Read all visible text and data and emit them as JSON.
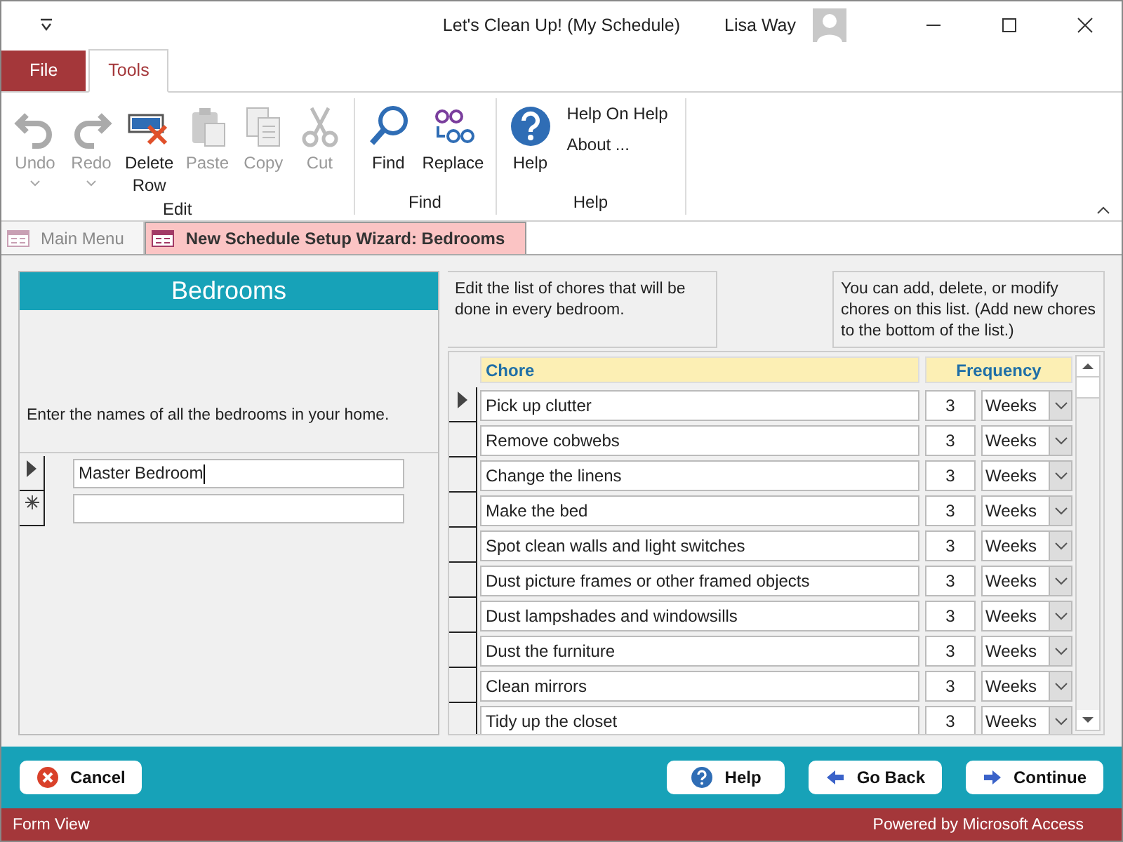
{
  "window": {
    "title": "Let's Clean Up! (My Schedule)",
    "user": "Lisa Way"
  },
  "ribbon_tabs": [
    {
      "label": "File",
      "kind": "file",
      "selected": false
    },
    {
      "label": "Tools",
      "kind": "tab",
      "selected": true
    }
  ],
  "ribbon_groups": [
    {
      "label": "Edit",
      "buttons": [
        {
          "label": "Undo",
          "kind": "large",
          "disabled": true,
          "dropdown": true
        },
        {
          "label": "Redo",
          "kind": "large",
          "disabled": true,
          "dropdown": true
        },
        {
          "label": "Delete Row",
          "kind": "large",
          "disabled": false
        },
        {
          "label": "Paste",
          "kind": "large",
          "disabled": true
        },
        {
          "label": "Copy",
          "kind": "large",
          "disabled": true
        },
        {
          "label": "Cut",
          "kind": "large",
          "disabled": true
        }
      ]
    },
    {
      "label": "Find",
      "buttons": [
        {
          "label": "Find",
          "kind": "large",
          "disabled": false
        },
        {
          "label": "Replace",
          "kind": "large",
          "disabled": false
        }
      ]
    },
    {
      "label": "Help",
      "buttons": [
        {
          "label": "Help",
          "kind": "large",
          "disabled": false
        },
        {
          "label": "Help On Help",
          "kind": "small",
          "disabled": false
        },
        {
          "label": "About ...",
          "kind": "small",
          "disabled": false
        }
      ]
    }
  ],
  "doc_tabs": [
    {
      "label": "Main Menu",
      "selected": false
    },
    {
      "label": "New Schedule Setup Wizard: Bedrooms",
      "selected": true
    }
  ],
  "bedrooms_panel": {
    "title": "Bedrooms",
    "instruction": "Enter the names of all the bedrooms in your home.",
    "rows": [
      {
        "kind": "current",
        "value": "Master Bedroom"
      },
      {
        "kind": "new"
      }
    ]
  },
  "chores_panel": {
    "note": "Edit the list of chores that will be done in every bedroom.",
    "hint": "You can add, delete, or modify chores on this list. (Add new chores to the bottom of the list.)",
    "columns": [
      "Chore",
      "Frequency"
    ],
    "rows": [
      {
        "chore": "Pick up clutter",
        "count": "3",
        "unit": "Weeks",
        "current": true
      },
      {
        "chore": "Remove cobwebs",
        "count": "3",
        "unit": "Weeks",
        "current": false
      },
      {
        "chore": "Change the linens",
        "count": "3",
        "unit": "Weeks",
        "current": false
      },
      {
        "chore": "Make the bed",
        "count": "3",
        "unit": "Weeks",
        "current": false
      },
      {
        "chore": "Spot clean walls and light switches",
        "count": "3",
        "unit": "Weeks",
        "current": false
      },
      {
        "chore": "Dust picture frames or other framed objects",
        "count": "3",
        "unit": "Weeks",
        "current": false
      },
      {
        "chore": "Dust lampshades and windowsills",
        "count": "3",
        "unit": "Weeks",
        "current": false
      },
      {
        "chore": "Dust the furniture",
        "count": "3",
        "unit": "Weeks",
        "current": false
      },
      {
        "chore": "Clean mirrors",
        "count": "3",
        "unit": "Weeks",
        "current": false
      },
      {
        "chore": "Tidy up the closet",
        "count": "3",
        "unit": "Weeks",
        "current": false
      }
    ]
  },
  "footer": {
    "left_buttons": [
      "Cancel"
    ],
    "right_buttons": [
      "Help",
      "Go Back",
      "Continue"
    ]
  },
  "status_bar": {
    "left": "Form View",
    "right": "Powered by Microsoft Access"
  }
}
